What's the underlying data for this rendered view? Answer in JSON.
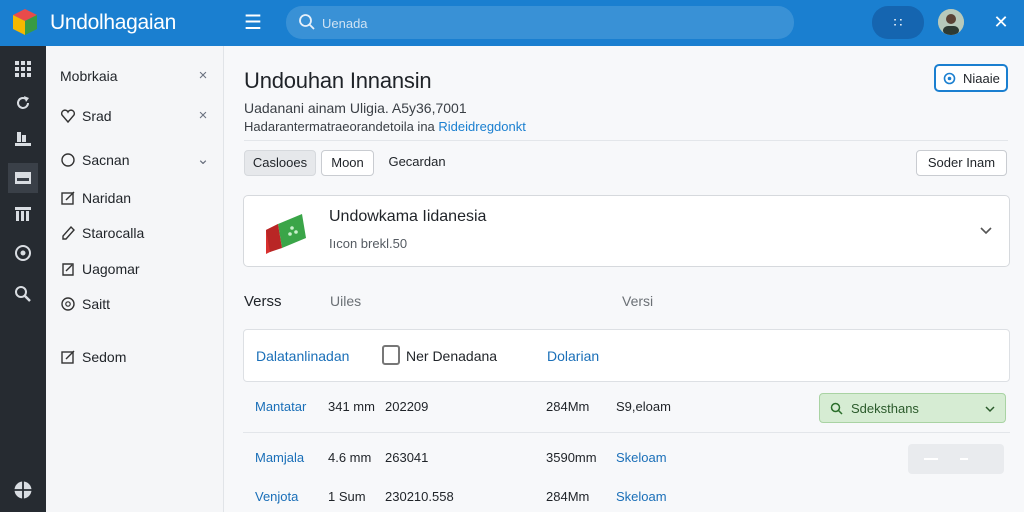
{
  "header": {
    "app_title": "Undolhagaian",
    "search_placeholder": "Uenada",
    "apps_label": "∷"
  },
  "colors": {
    "topbar": "#1a7fd0",
    "rail": "#262b31",
    "link": "#1a6fb8",
    "success_bg": "#d6ecd3"
  },
  "rail": {
    "items": [
      {
        "icon": "grid-icon"
      },
      {
        "icon": "refresh-icon"
      },
      {
        "icon": "shelf-icon"
      },
      {
        "icon": "download-icon"
      },
      {
        "icon": "library-icon"
      },
      {
        "icon": "compass-icon"
      },
      {
        "icon": "search-icon"
      },
      {
        "icon": "globe-icon"
      }
    ]
  },
  "sidebar": {
    "items": [
      {
        "label": "Mobrkaia",
        "icon": "",
        "action": "×"
      },
      {
        "label": "Srad",
        "icon": "heart-icon",
        "action": "×"
      },
      {
        "label": "Sacnan",
        "icon": "circle-icon",
        "action": "⌄"
      },
      {
        "label": "Naridan",
        "icon": "edit-icon",
        "action": ""
      },
      {
        "label": "Starocalla",
        "icon": "pen-icon",
        "action": ""
      },
      {
        "label": "Uagomar",
        "icon": "note-icon",
        "action": ""
      },
      {
        "label": "Saitt",
        "icon": "settings-icon",
        "action": ""
      },
      {
        "label": "Sedom",
        "icon": "edit-icon",
        "action": ""
      }
    ]
  },
  "main": {
    "title": "Undouhan Innansin",
    "meta_line1": "Uadanani ainam Uligia. A5y36,7001",
    "meta_line2_prefix": "Hadarantermatraeorandetoila ina ",
    "meta_line2_link": "Rideidregdonkt",
    "top_action_label": "Niaaie",
    "tabs": [
      "Caslooes",
      "Moon",
      "Gecardan"
    ],
    "right_button": "Soder Inam",
    "card": {
      "title": "Undowkama Iidanesia",
      "subtitle": "Iıcon   brekl.50"
    },
    "columns": {
      "c1": "Verss",
      "c2": "Uiles",
      "c3": "Versi"
    },
    "table_header": {
      "c1": "Dalatanlinadan",
      "c2": "Ner Denadana",
      "c3": "Dolarian"
    },
    "rows": [
      {
        "name": "Mantatar",
        "size": "341 mm",
        "date": "202209",
        "size2": "284Mm",
        "status": "S9,eloam"
      },
      {
        "name": "Mamjala",
        "size": "4.6 mm",
        "date": "263041",
        "size2": "3590mm",
        "status": "Skeloam"
      },
      {
        "name": "Venjota",
        "size": "1 Sum",
        "date": "230210.558",
        "size2": "284Mm",
        "status": "Skeloam"
      }
    ],
    "download_button": "Sdeksthans"
  }
}
